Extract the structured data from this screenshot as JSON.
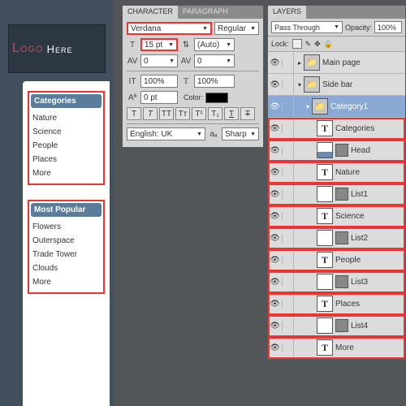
{
  "preview": {
    "logo1": "Logo",
    "logo2": "Here",
    "categories": {
      "title": "Categories",
      "items": [
        "Nature",
        "Science",
        "People",
        "Places",
        "More"
      ]
    },
    "popular": {
      "title": "Most Popular",
      "items": [
        "Flowers",
        "Outerspace",
        "Trade Tower",
        "Clouds",
        "More"
      ]
    }
  },
  "charPanel": {
    "tabs": [
      "CHARACTER",
      "PARAGRAPH"
    ],
    "font": "Verdana",
    "style": "Regular",
    "size": "15 pt",
    "leading": "(Auto)",
    "kern": "0",
    "tracking": "0",
    "vscale": "100%",
    "hscale": "100%",
    "baseline": "0 pt",
    "colorLabel": "Color:",
    "lang": "English: UK",
    "aa": "Sharp"
  },
  "layersPanel": {
    "tab": "LAYERS",
    "blend": "Pass Through",
    "opLabel": "Opacity:",
    "opacity": "100%",
    "lockLabel": "Lock:",
    "groups": {
      "main": "Main page",
      "sidebar": "Side bar",
      "cat1": "Category1"
    },
    "layers": [
      "Categories",
      "Head",
      "Nature",
      "List1",
      "Science",
      "List2",
      "People",
      "List3",
      "Places",
      "List4",
      "More"
    ]
  }
}
